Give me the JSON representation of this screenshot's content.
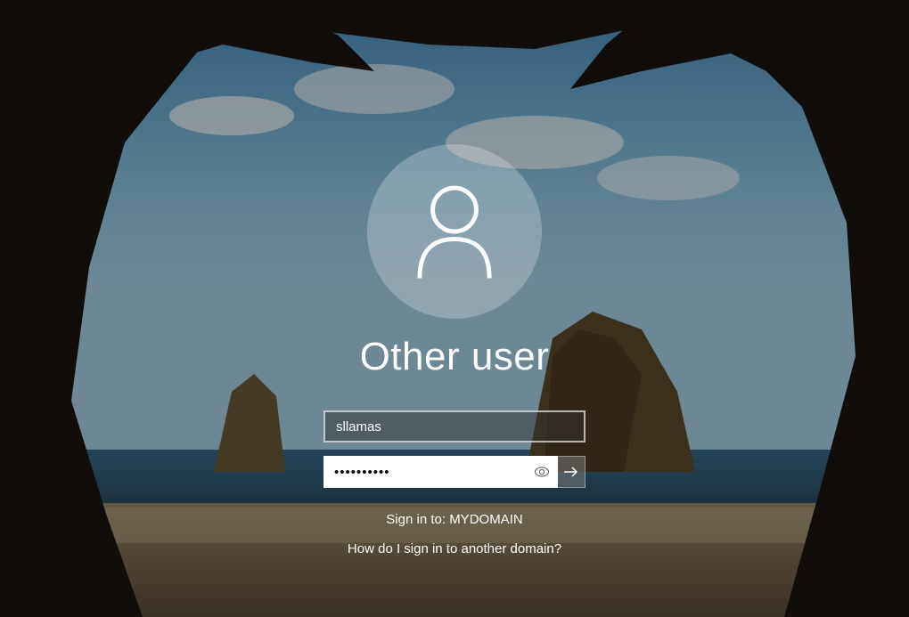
{
  "title": "Other user",
  "username": {
    "value": "sllamas"
  },
  "password": {
    "masked_value": "••••••••••"
  },
  "signin_label": "Sign in to: ",
  "domain_name": "MYDOMAIN",
  "domain_help_text": "How do I sign in to another domain?"
}
